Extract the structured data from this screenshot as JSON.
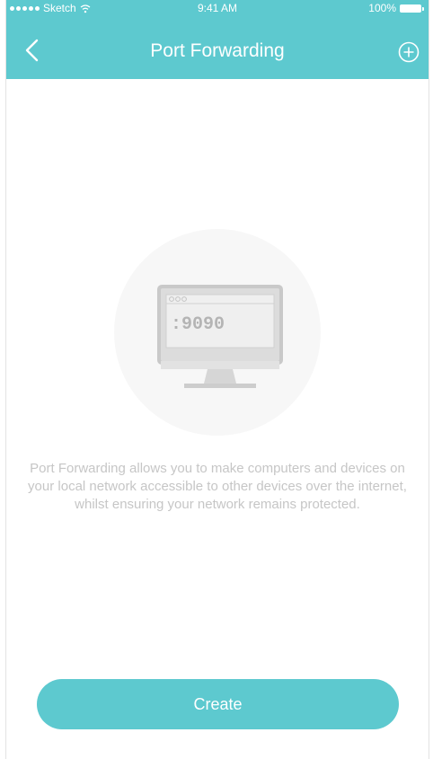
{
  "status_bar": {
    "carrier": "Sketch",
    "time": "9:41 AM",
    "battery": "100%"
  },
  "nav": {
    "title": "Port Forwarding"
  },
  "illustration": {
    "port": ":9090"
  },
  "description": "Port Forwarding allows you to make computers and devices on your local network accessible to other devices over the internet, whilst ensuring your network remains protected.",
  "actions": {
    "create": "Create"
  },
  "colors": {
    "accent": "#5dc9cf",
    "text_muted": "#c6c6c6"
  },
  "icons": {
    "back": "chevron-left-icon",
    "add": "plus-circle-icon",
    "wifi": "wifi-icon",
    "battery": "battery-icon"
  }
}
